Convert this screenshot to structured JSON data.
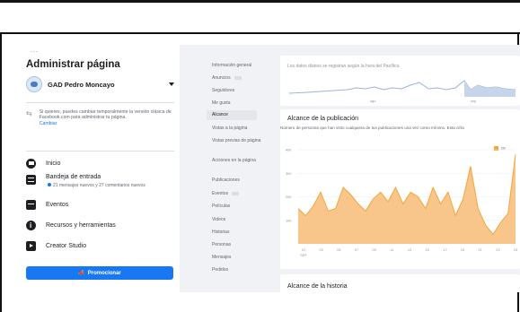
{
  "sidebar": {
    "handle": "...",
    "title": "Administrar página",
    "page_name": "GAD Pedro Moncayo",
    "notice": {
      "text": "Si quieres, puedes cambiar temporalmente la versión clásica de Facebook.com para administrar tu página.",
      "link": "Cambiar"
    },
    "items": [
      {
        "label": "Inicio",
        "icon": "home-icon"
      },
      {
        "label": "Bandeja de entrada",
        "icon": "inbox-icon",
        "sub": "21 mensajes nuevos y 27 comentarios nuevos"
      },
      {
        "label": "Eventos",
        "icon": "calendar-icon"
      },
      {
        "label": "Recursos y herramientas",
        "icon": "info-icon"
      },
      {
        "label": "Creator Studio",
        "icon": "creator-studio-icon"
      }
    ],
    "promote_label": "Promocionar"
  },
  "submenu": {
    "items": [
      "Información general",
      "Anuncios",
      "Seguidores",
      "Me gusta",
      "Alcance",
      "Vistas a la página",
      "Vistas previas de página",
      "Acciones en la página",
      "Publicaciones",
      "Eventos",
      "Películas",
      "Videos",
      "Historias",
      "Personas",
      "Mensajes",
      "Pedidos"
    ],
    "active": "Alcance"
  },
  "panel_top": {
    "text": "Los datos diarios se registran según la hora del Pacífico.",
    "tick_labels": [
      "ago",
      "sep"
    ]
  },
  "panel_reach": {
    "title": "Alcance de la publicación",
    "description": "Número de personas que han visto cualquiera de tus publicaciones una vez como mínimo. Esta cifra",
    "legend": "Or",
    "y_ticks": [
      "40K",
      "30K",
      "20K",
      "10K"
    ],
    "x_ticks": [
      "01",
      "03",
      "05",
      "07",
      "09",
      "11",
      "13",
      "15",
      "17",
      "19",
      "21",
      "23",
      "25"
    ],
    "x_sub": "SEP"
  },
  "panel_story": {
    "title": "Alcance de la historia"
  },
  "colors": {
    "accent": "#1877f2",
    "area_fill": "#f8c58a",
    "area_stroke": "#f5a53a",
    "sparkline": "#9bb3d6"
  },
  "chart_data": {
    "type": "area",
    "title": "Alcance de la publicación",
    "ylim": [
      0,
      40000
    ],
    "x": [
      1,
      2,
      3,
      4,
      5,
      6,
      7,
      8,
      9,
      10,
      11,
      12,
      13,
      14,
      15,
      16,
      17,
      18,
      19,
      20,
      21,
      22,
      23,
      24,
      25,
      26,
      27,
      28,
      29,
      30
    ],
    "series": [
      {
        "name": "Or",
        "values": [
          15000,
          12000,
          16000,
          22000,
          14000,
          15000,
          24000,
          21000,
          17000,
          14000,
          19000,
          22000,
          18000,
          24000,
          17000,
          22000,
          20000,
          15000,
          24000,
          17000,
          22000,
          12000,
          19000,
          33000,
          15000,
          8000,
          4000,
          9000,
          13000,
          38000
        ]
      }
    ]
  }
}
